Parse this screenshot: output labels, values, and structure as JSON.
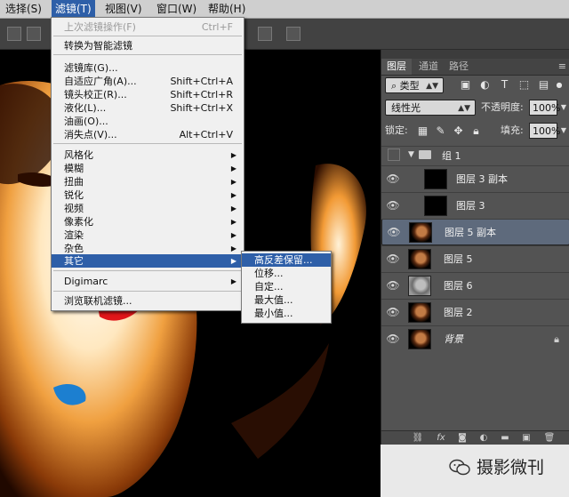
{
  "menubar": {
    "items": [
      "选择(S)",
      "滤镜(T)",
      "视图(V)",
      "窗口(W)",
      "帮助(H)"
    ]
  },
  "filter_menu": {
    "items": [
      {
        "label": "上次滤镜操作(F)",
        "shortcut": "Ctrl+F",
        "disabled": true
      },
      {
        "label": "转换为智能滤镜"
      },
      {
        "label": "滤镜库(G)..."
      },
      {
        "label": "自适应广角(A)...",
        "shortcut": "Shift+Ctrl+A"
      },
      {
        "label": "镜头校正(R)...",
        "shortcut": "Shift+Ctrl+R"
      },
      {
        "label": "液化(L)...",
        "shortcut": "Shift+Ctrl+X"
      },
      {
        "label": "油画(O)..."
      },
      {
        "label": "消失点(V)...",
        "shortcut": "Alt+Ctrl+V"
      },
      {
        "label": "风格化"
      },
      {
        "label": "模糊"
      },
      {
        "label": "扭曲"
      },
      {
        "label": "锐化"
      },
      {
        "label": "视频"
      },
      {
        "label": "像素化"
      },
      {
        "label": "渲染"
      },
      {
        "label": "杂色"
      },
      {
        "label": "其它",
        "highlighted": true
      },
      {
        "label": "Digimarc"
      },
      {
        "label": "浏览联机滤镜..."
      }
    ]
  },
  "other_submenu": {
    "items": [
      "高反差保留...",
      "位移...",
      "自定...",
      "最大值...",
      "最小值..."
    ]
  },
  "layers_panel": {
    "tabs": [
      "图层",
      "通道",
      "路径"
    ],
    "filter_kind": "类型",
    "blend_mode": "线性光",
    "opacity_label": "不透明度:",
    "opacity_value": "100%",
    "lock_label": "锁定:",
    "fill_label": "填充:",
    "fill_value": "100%",
    "layers": [
      {
        "name": "组 1",
        "type": "group"
      },
      {
        "name": "图层 3 副本",
        "thumb": "black"
      },
      {
        "name": "图层 3",
        "thumb": "black"
      },
      {
        "name": "图层 5 副本",
        "thumb": "face",
        "selected": true
      },
      {
        "name": "图层 5",
        "thumb": "face"
      },
      {
        "name": "图层 6",
        "thumb": "grey"
      },
      {
        "name": "图层 2",
        "thumb": "face"
      },
      {
        "name": "背景",
        "thumb": "face",
        "locked": true
      }
    ]
  },
  "watermark": {
    "text": "摄影微刊"
  },
  "colors": {
    "highlight": "#2e5fa8",
    "menubar": "#cfcfcf",
    "panel": "#535353"
  }
}
